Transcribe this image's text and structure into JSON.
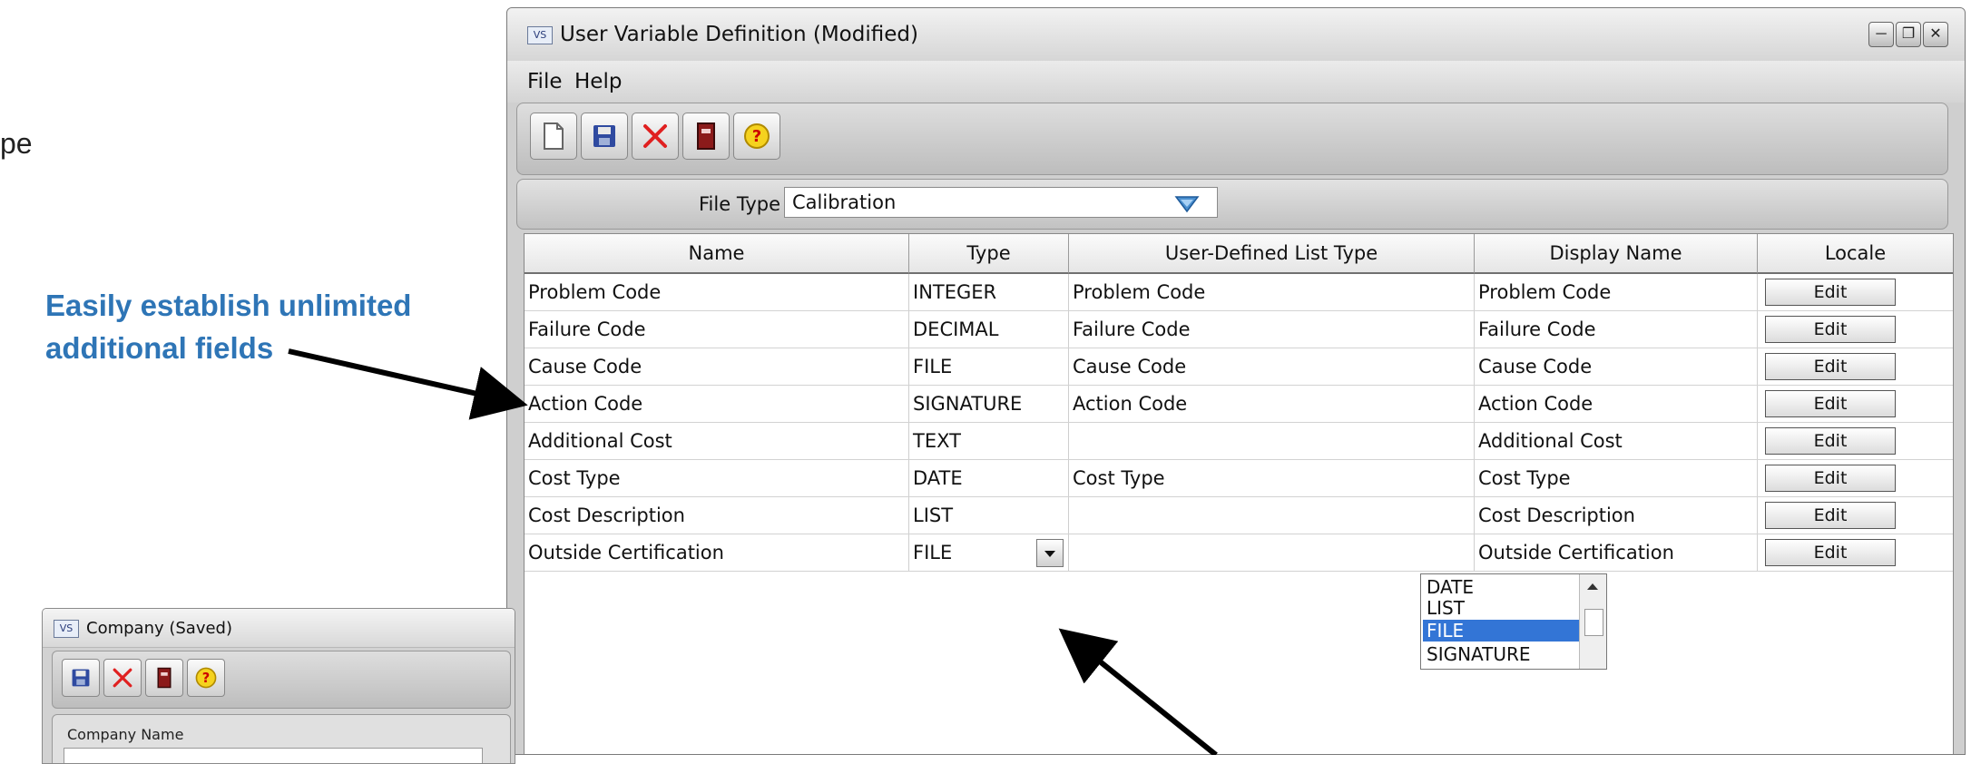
{
  "slide": {
    "top_fragment": "",
    "left_fragment": "pe",
    "callout": "Easily establish unlimited additional fields",
    "callout_color": "#2e75b6"
  },
  "window": {
    "title": "User  Variable Definition (Modified)",
    "icon_text": "VS",
    "controls": [
      "minimize",
      "maximize",
      "close"
    ]
  },
  "menu": [
    "File",
    "Help"
  ],
  "toolbar": {
    "buttons": [
      "new-file-icon",
      "save-icon",
      "delete-icon",
      "exit-door-icon",
      "help-icon"
    ]
  },
  "file_type": {
    "label": "File Type",
    "value": "Calibration"
  },
  "grid": {
    "columns": [
      "Name",
      "Type",
      "User-Defined List Type",
      "Display Name",
      "Locale"
    ],
    "edit_label": "Edit",
    "rows": [
      {
        "name": "Problem Code",
        "type": "INTEGER",
        "list_type": "Problem Code",
        "display": "Problem Code"
      },
      {
        "name": "Failure Code",
        "type": "DECIMAL",
        "list_type": "Failure Code",
        "display": "Failure Code"
      },
      {
        "name": "Cause Code",
        "type": "FILE",
        "list_type": "Cause Code",
        "display": "Cause Code"
      },
      {
        "name": "Action Code",
        "type": "SIGNATURE",
        "list_type": "Action Code",
        "display": "Action Code"
      },
      {
        "name": "Additional Cost",
        "type": "TEXT",
        "list_type": "",
        "display": "Additional Cost"
      },
      {
        "name": "Cost Type",
        "type": "DATE",
        "list_type": "Cost Type",
        "display": "Cost Type"
      },
      {
        "name": "Cost Description",
        "type": "LIST",
        "list_type": "",
        "display": "Cost Description"
      },
      {
        "name": "Outside Certification",
        "type": "FILE",
        "list_type": "",
        "display": "Outside Certification"
      }
    ]
  },
  "type_dropdown": {
    "options": [
      "DATE",
      "LIST",
      "FILE",
      "SIGNATURE"
    ],
    "selected": "FILE",
    "selected_color": "#3375d6"
  },
  "company_window": {
    "title": "Company (Saved)",
    "field_label": "Company Name",
    "toolbar": [
      "save-icon",
      "delete-icon",
      "exit-door-icon",
      "help-icon"
    ]
  }
}
